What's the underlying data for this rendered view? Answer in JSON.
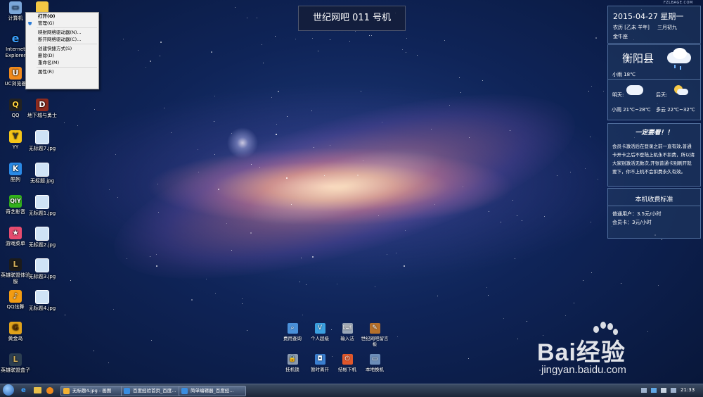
{
  "desktop": {
    "icons_left": [
      {
        "label": "计算机",
        "icon": "computer-icon"
      },
      {
        "label": "Internet Explorer",
        "icon": "ie-icon"
      },
      {
        "label": "UC浏览器",
        "icon": "uc-browser-icon"
      },
      {
        "label": "QQ",
        "icon": "qq-icon"
      },
      {
        "label": "YY",
        "icon": "yy-icon"
      },
      {
        "label": "酷狗",
        "icon": "kugou-icon"
      },
      {
        "label": "奇艺影音",
        "icon": "iqiyi-icon"
      },
      {
        "label": "游戏菜单",
        "icon": "game-menu-icon"
      },
      {
        "label": "英雄联盟体验服",
        "icon": "lol-icon"
      },
      {
        "label": "QQ炫舞",
        "icon": "qq-dance-icon"
      },
      {
        "label": "黄金岛",
        "icon": "gold-island-icon"
      },
      {
        "label": "英雄联盟盒子",
        "icon": "lol-box-icon"
      }
    ],
    "icons_col2": [
      {
        "label": "",
        "icon": "folder-icon"
      },
      {
        "label": "地下城与勇士",
        "icon": "dnf-icon"
      },
      {
        "label": "无标题7.jpg",
        "icon": "image-file-icon"
      },
      {
        "label": "无标题.jpg",
        "icon": "image-file-icon"
      },
      {
        "label": "无标题1.jpg",
        "icon": "image-file-icon"
      },
      {
        "label": "无标题2.jpg",
        "icon": "image-file-icon"
      },
      {
        "label": "无标题3.jpg",
        "icon": "image-file-icon"
      },
      {
        "label": "无标题4.jpg",
        "icon": "image-file-icon"
      }
    ]
  },
  "context_menu": {
    "items": [
      "打开(O)",
      "管理(G)",
      "映射网络驱动器(N)...",
      "断开网络驱动器(C)...",
      "创建快捷方式(S)",
      "删除(D)",
      "重命名(M)",
      "属性(R)"
    ]
  },
  "banner": {
    "title": "世纪网吧 011 号机"
  },
  "date_panel": {
    "date": "2015-04-27 星期一",
    "lunar": "农历 [乙未 羊年]",
    "lunar_day": "三月初九",
    "constellation": "金牛座"
  },
  "weather_panel": {
    "city": "衡阳县",
    "today": "小雨 18℃",
    "tomorrow_label": "明天:",
    "after_label": "后天:",
    "tomorrow": "小雨 21℃~28℃",
    "after": "多云 22℃~32℃"
  },
  "notice_panel": {
    "title": "一定要看！！",
    "text": "会员卡激活后在登录之前一直有效,普通卡开卡之后不登陆上机永不扣费，所以请大家别激活无数次,开张普通卡别刷开就要下，你不上机不会扣费永久有效。"
  },
  "fee_panel": {
    "title": "本机收费标准",
    "normal": "普通用户：3.5元/小时",
    "member": "会员卡：3元/小时"
  },
  "dock": {
    "row1": [
      "费用查询",
      "个人超级",
      "输入法",
      "世纪网吧留言板"
    ],
    "row2": [
      "挂机锁",
      "暂时离开",
      "结帐下机",
      "本地换机"
    ]
  },
  "watermark": {
    "top_right": "FZLBAGE.COM",
    "brand": "Bai经验",
    "url": "jingyan.baidu.com"
  },
  "taskbar": {
    "tasks": [
      "无标题4.jpg - 画图",
      "百度经验首页_百度...",
      "简单编辑器_百度经..."
    ],
    "clock": "21:33"
  },
  "colors": {
    "menu_bg": "#f1f1f1",
    "panel_border": "#96bef0",
    "taskbar": "#1c2638"
  }
}
